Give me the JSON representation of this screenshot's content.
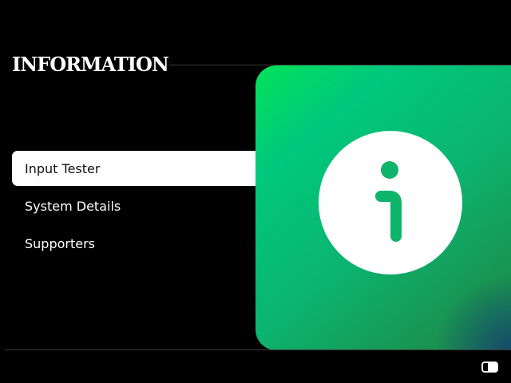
{
  "header": {
    "title": "INFORMATION"
  },
  "menu": {
    "items": [
      {
        "label": "Input Tester",
        "active": true
      },
      {
        "label": "System Details",
        "active": false
      },
      {
        "label": "Supporters",
        "active": false
      }
    ]
  },
  "preview": {
    "icon": "info-icon"
  },
  "footer": {
    "icon": "window-toggle-icon"
  },
  "colors": {
    "background": "#000000",
    "accent_green": "#00c97c",
    "selected_item_bg": "#ffffff"
  }
}
